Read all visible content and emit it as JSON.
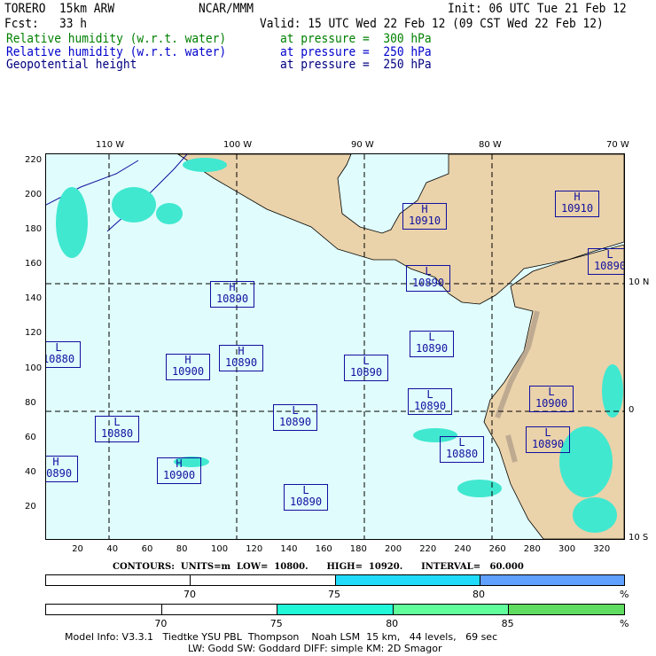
{
  "header": {
    "model": "TORERO  15km ARW",
    "org": "NCAR/MMM",
    "init": "Init: 06 UTC Tue 21 Feb 12",
    "fcst": "Fcst:   33 h",
    "valid": "Valid: 15 UTC Wed 22 Feb 12 (09 CST Wed 22 Feb 12)",
    "fields": [
      {
        "name": "Relative humidity (w.r.t. water)",
        "level": "at pressure =  300 hPa",
        "color": "#008000"
      },
      {
        "name": "Relative humidity (w.r.t. water)",
        "level": "at pressure =  250 hPa",
        "color": "#0000cc"
      },
      {
        "name": "Geopotential height",
        "level": "at pressure =  250 hPa",
        "color": "#000080"
      }
    ]
  },
  "map": {
    "lon_labels": [
      "110 W",
      "100 W",
      "90 W",
      "80 W",
      "70 W"
    ],
    "lat_labels": [
      "10 N",
      "0",
      "10 S"
    ],
    "x_ticks": [
      "20",
      "40",
      "60",
      "80",
      "100",
      "120",
      "140",
      "160",
      "180",
      "200",
      "220",
      "240",
      "260",
      "280",
      "300",
      "320"
    ],
    "y_ticks": [
      "20",
      "40",
      "60",
      "80",
      "100",
      "120",
      "140",
      "160",
      "180",
      "200",
      "220"
    ],
    "centers": [
      {
        "type": "H",
        "value": "10910"
      },
      {
        "type": "H",
        "value": "10910"
      },
      {
        "type": "L",
        "value": "10890"
      },
      {
        "type": "L",
        "value": "10890"
      },
      {
        "type": "H",
        "value": "10890"
      },
      {
        "type": "L",
        "value": "10880"
      },
      {
        "type": "H",
        "value": "10890"
      },
      {
        "type": "H",
        "value": "10900"
      },
      {
        "type": "L",
        "value": "10890"
      },
      {
        "type": "L",
        "value": "10890"
      },
      {
        "type": "L",
        "value": "10890"
      },
      {
        "type": "L",
        "value": "10900"
      },
      {
        "type": "L",
        "value": "10890"
      },
      {
        "type": "L",
        "value": "10880"
      },
      {
        "type": "L",
        "value": "10890"
      },
      {
        "type": "L",
        "value": "10880"
      },
      {
        "type": "H",
        "value": "10890"
      },
      {
        "type": "H",
        "value": "10900"
      },
      {
        "type": "L",
        "value": "10890"
      }
    ]
  },
  "contours": "CONTOURS:  UNITS=m  LOW=  10800.      HIGH=  10920.      INTERVAL=   60.000",
  "legend1": {
    "labels": [
      "70",
      "75",
      "80",
      "%"
    ],
    "colors": [
      "#ffffff",
      "#ffffff",
      "#20dcfa",
      "#60a0ff"
    ]
  },
  "legend2": {
    "labels": [
      "70",
      "75",
      "80",
      "85",
      "%"
    ],
    "colors": [
      "#ffffff",
      "#ffffff",
      "#20f8d8",
      "#60ff9c",
      "#60dc60"
    ]
  },
  "footer": {
    "line1": "Model Info: V3.3.1   Tiedtke YSU PBL  Thompson    Noah LSM  15 km,   44 levels,   69 sec",
    "line2": "LW: Godd SW: Goddard DIFF: simple KM: 2D Smagor"
  }
}
